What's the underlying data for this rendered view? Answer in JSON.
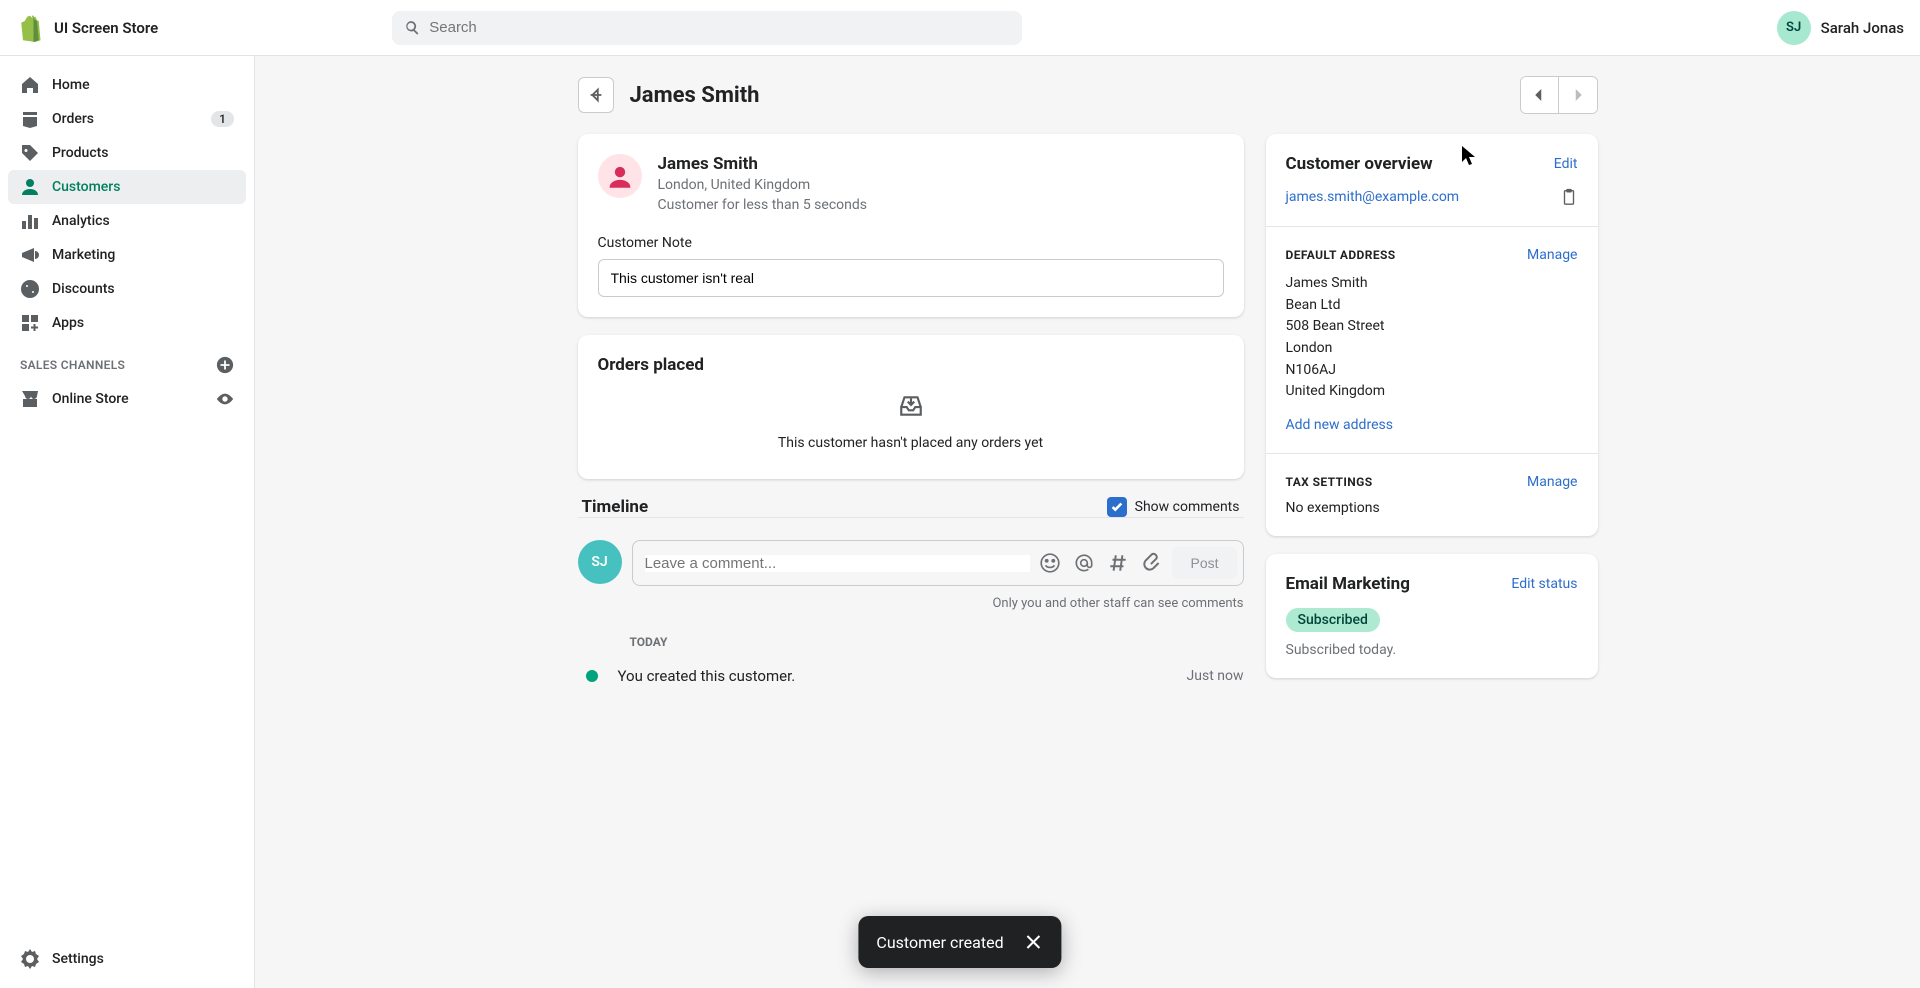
{
  "store_name": "UI Screen Store",
  "search_placeholder": "Search",
  "user": {
    "initials": "SJ",
    "name": "Sarah Jonas"
  },
  "sidebar": {
    "home": "Home",
    "orders": "Orders",
    "orders_badge": "1",
    "products": "Products",
    "customers": "Customers",
    "analytics": "Analytics",
    "marketing": "Marketing",
    "discounts": "Discounts",
    "apps": "Apps",
    "section_label": "SALES CHANNELS",
    "online_store": "Online Store",
    "settings": "Settings"
  },
  "page_title": "James Smith",
  "customer": {
    "name": "James Smith",
    "location": "London, United Kingdom",
    "tenure": "Customer for less than 5 seconds",
    "note_label": "Customer Note",
    "note_value": "This customer isn't real"
  },
  "orders_card": {
    "title": "Orders placed",
    "empty_text": "This customer hasn't placed any orders yet"
  },
  "timeline": {
    "title": "Timeline",
    "show_comments": "Show comments",
    "comment_placeholder": "Leave a comment...",
    "post": "Post",
    "hint": "Only you and other staff can see comments",
    "day_label": "TODAY",
    "event_text": "You created this customer.",
    "event_time": "Just now",
    "avatar_initials": "SJ"
  },
  "overview": {
    "title": "Customer overview",
    "edit": "Edit",
    "email": "james.smith@example.com",
    "address_label": "DEFAULT ADDRESS",
    "manage": "Manage",
    "addr_name": "James Smith",
    "addr_company": "Bean Ltd",
    "addr_street": "508 Bean Street",
    "addr_city": "London",
    "addr_postal": "N106AJ",
    "addr_country": "United Kingdom",
    "add_address": "Add new address",
    "tax_label": "TAX SETTINGS",
    "tax_text": "No exemptions"
  },
  "email_marketing": {
    "title": "Email Marketing",
    "edit_status": "Edit status",
    "pill": "Subscribed",
    "sub_text": "Subscribed today."
  },
  "toast": {
    "text": "Customer created"
  }
}
